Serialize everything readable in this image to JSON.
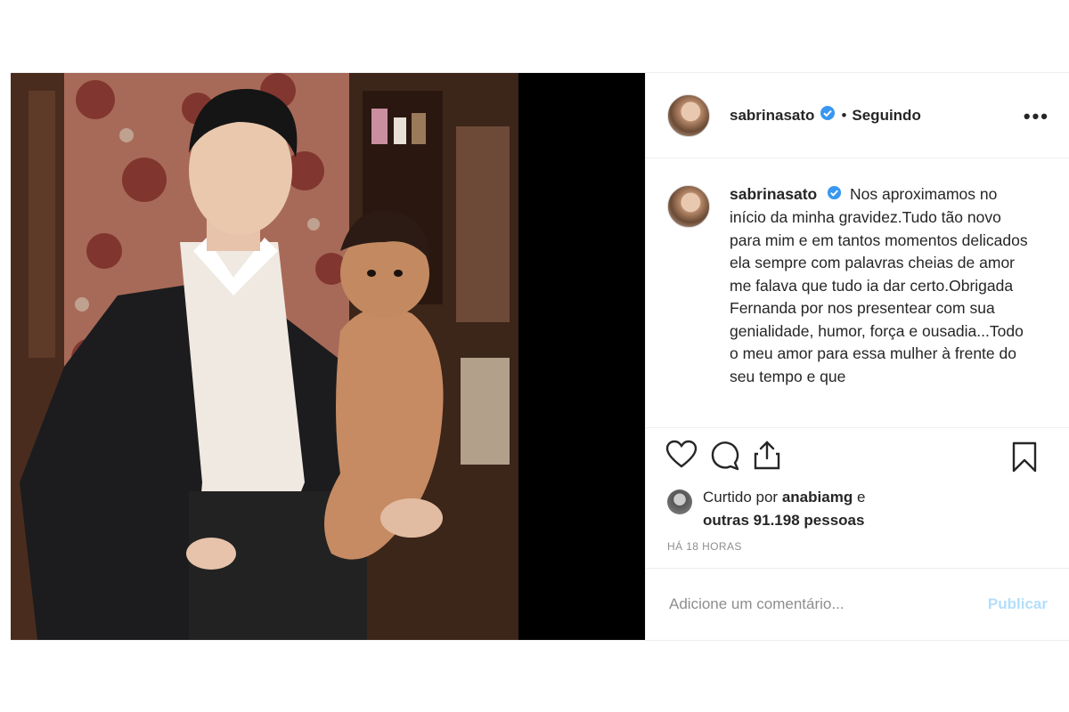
{
  "header": {
    "username": "sabrinasato",
    "dot": "•",
    "follow_status": "Seguindo",
    "more_glyph": "•••"
  },
  "caption": {
    "username": "sabrinasato",
    "text": "Nos aproximamos no início da minha gravidez.Tudo tão novo para mim e em tantos momentos delicados ela sempre com palavras cheias de amor me falava que tudo ia dar certo.Obrigada Fernanda por nos presentear com sua genialidade, humor, força e ousadia...Todo o meu amor para essa mulher à frente do seu tempo e que"
  },
  "likes": {
    "prefix": "Curtido por",
    "user": "anabiamg",
    "joiner": "e",
    "others": "outras 91.198 pessoas"
  },
  "timestamp": "HÁ 18 HORAS",
  "comment": {
    "placeholder": "Adicione um comentário...",
    "publish_label": "Publicar"
  },
  "icons": {
    "verified": "verified-badge-icon",
    "like": "heart-icon",
    "comment": "comment-icon",
    "share": "share-icon",
    "save": "bookmark-icon"
  },
  "colors": {
    "verified_blue": "#3897f0",
    "publish_disabled": "#b2dffc",
    "muted_text": "#8e8e8e"
  }
}
